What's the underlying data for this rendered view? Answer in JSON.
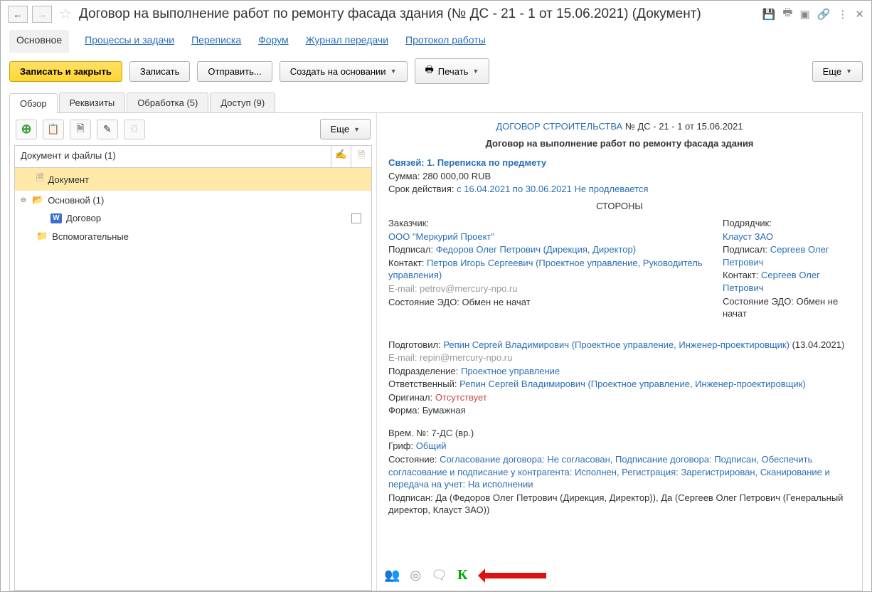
{
  "title": "Договор  на  выполнение работ по ремонту фасада здания (№ ДС - 21 - 1 от 15.06.2021) (Документ)",
  "navTabs": {
    "main": "Основное",
    "processes": "Процессы и задачи",
    "correspondence": "Переписка",
    "forum": "Форум",
    "transferLog": "Журнал передачи",
    "workProtocol": "Протокол работы"
  },
  "toolbar": {
    "saveClose": "Записать и закрыть",
    "save": "Записать",
    "send": "Отправить...",
    "createBased": "Создать на основании",
    "print": "Печать",
    "more": "Еще"
  },
  "contentTabs": {
    "overview": "Обзор",
    "props": "Реквизиты",
    "processing": "Обработка (5)",
    "access": "Доступ (9)"
  },
  "leftMore": "Еще",
  "treeHeader": "Документ и файлы (1)",
  "tree": {
    "rootDoc": "Документ",
    "mainFolder": "Основной (1)",
    "contract": "Договор",
    "aux": "Вспомогательные"
  },
  "doc": {
    "typeCaps": "ДОГОВОР СТРОИТЕЛЬСТВА",
    "numDate": "№ ДС - 21 - 1 от 15.06.2021",
    "name": "Договор на выполнение работ по ремонту фасада здания",
    "linksLine": "Связей: 1. Переписка по предмету",
    "sumLabel": "Сумма:",
    "sumValue": "280 000,00 RUB",
    "validityLabel": "Срок действия:",
    "validityValue": "с 16.04.2021 по 30.06.2021 Не продлевается",
    "partiesTitle": "СТОРОНЫ",
    "customer": {
      "hdr": "Заказчик:",
      "org": "ООО \"Меркурий Проект\"",
      "signedLabel": "Подписал:",
      "signed": "Федоров Олег Петрович (Дирекция, Директор)",
      "contactLabel": "Контакт:",
      "contact": "Петров Игорь Сергеевич (Проектное управление, Руководитель управления)",
      "email": "E-mail: petrov@mercury-npo.ru",
      "edoLabel": "Состояние ЭДО:",
      "edo": "Обмен не начат"
    },
    "contractor": {
      "hdr": "Подрядчик:",
      "org": "Клауст ЗАО",
      "signedLabel": "Подписал:",
      "signed": "Сергеев Олег Петрович",
      "contactLabel": "Контакт:",
      "contact": "Сергеев Олег Петрович",
      "edoLabel": "Состояние ЭДО:",
      "edo": "Обмен не начат"
    },
    "preparedLabel": "Подготовил:",
    "prepared": "Репин Сергей Владимирович (Проектное управление, Инженер-проектировщик)",
    "preparedDate": "(13.04.2021)",
    "preparedEmail": "E-mail: repin@mercury-npo.ru",
    "deptLabel": "Подразделение:",
    "dept": "Проектное управление",
    "respLabel": "Ответственный:",
    "resp": "Репин Сергей Владимирович (Проектное управление, Инженер-проектировщик)",
    "origLabel": "Оригинал:",
    "orig": "Отсутствует",
    "formLabel": "Форма:",
    "form": "Бумажная",
    "tempNoLabel": "Врем. №:",
    "tempNo": "7-ДС (вр.)",
    "grifLabel": "Гриф:",
    "grif": "Общий",
    "stateLabel": "Состояние:",
    "state": "Согласование договора: Не согласован, Подписание договора: Подписан, Обеспечить согласование и подписание у контрагента: Исполнен, Регистрация: Зарегистрирован, Сканирование и передача на учет: На исполнении",
    "signedSummaryLabel": "Подписан:",
    "signedSummary": "Да (Федоров Олег Петрович (Дирекция, Директор)), Да (Сергеев Олег Петрович (Генеральный директор, Клауст ЗАО))"
  },
  "bottomK": "К"
}
